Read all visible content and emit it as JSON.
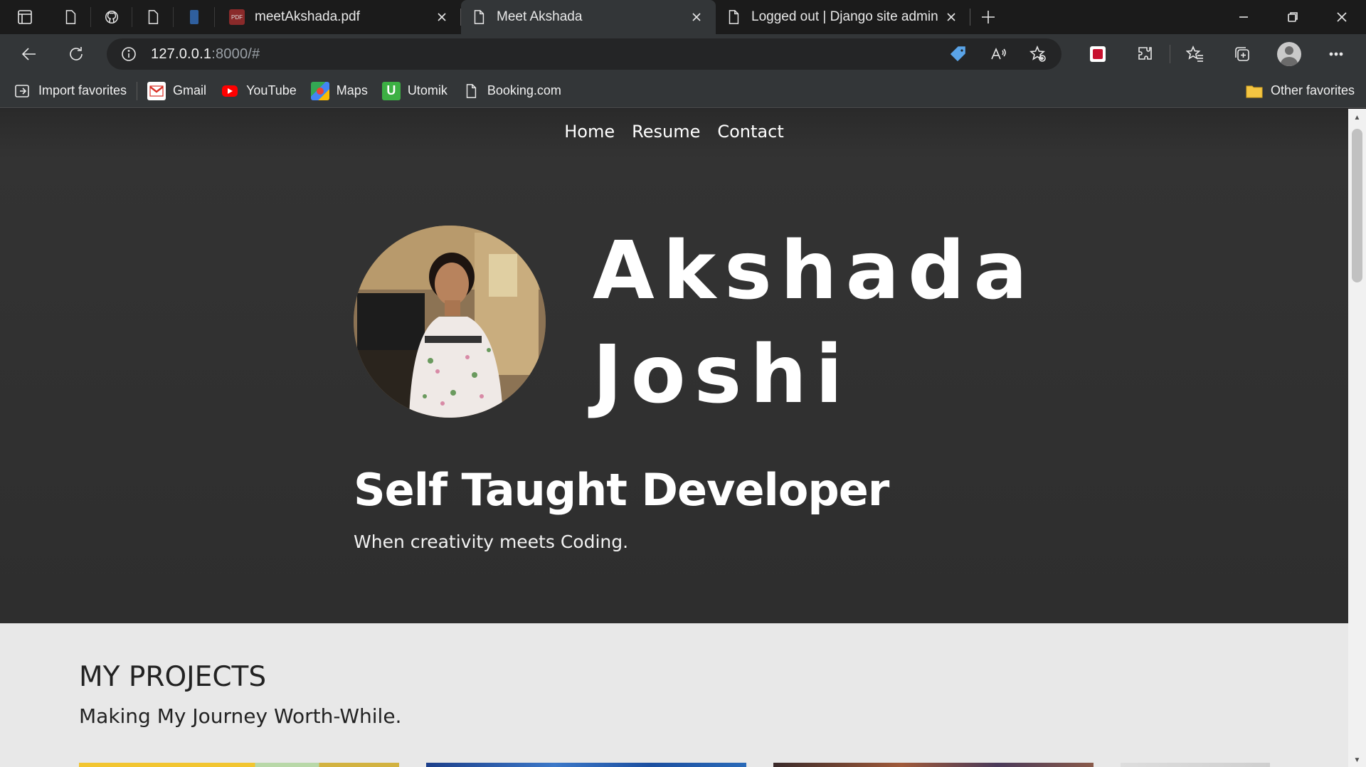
{
  "browser": {
    "tabs": [
      {
        "title": "meetAkshada.pdf",
        "active": false
      },
      {
        "title": "Meet Akshada",
        "active": true
      },
      {
        "title": "Logged out | Django site admin",
        "active": false
      }
    ],
    "address": {
      "host": "127.0.0.1",
      "rest": ":8000/#"
    },
    "favorites": [
      {
        "label": "Import favorites",
        "icon": "import-icon"
      },
      {
        "label": "Gmail",
        "icon": "gmail-icon"
      },
      {
        "label": "YouTube",
        "icon": "youtube-icon"
      },
      {
        "label": "Maps",
        "icon": "maps-icon"
      },
      {
        "label": "Utomik",
        "icon": "utomik-icon"
      },
      {
        "label": "Booking.com",
        "icon": "page-icon"
      }
    ],
    "other_favorites": "Other favorites"
  },
  "page": {
    "nav": [
      "Home",
      "Resume",
      "Contact"
    ],
    "name_line1": "Akshada",
    "name_line2": "Joshi",
    "headline": "Self Taught Developer",
    "tagline": "When creativity meets Coding.",
    "projects_title": "MY PROJECTS",
    "projects_subtitle": "Making My Journey Worth-While."
  },
  "colors": {
    "hero_bg": "#2e2e2e",
    "projects_bg": "#e8e8e8",
    "tab_active": "#333638",
    "tabbar": "#1b1b1b"
  }
}
